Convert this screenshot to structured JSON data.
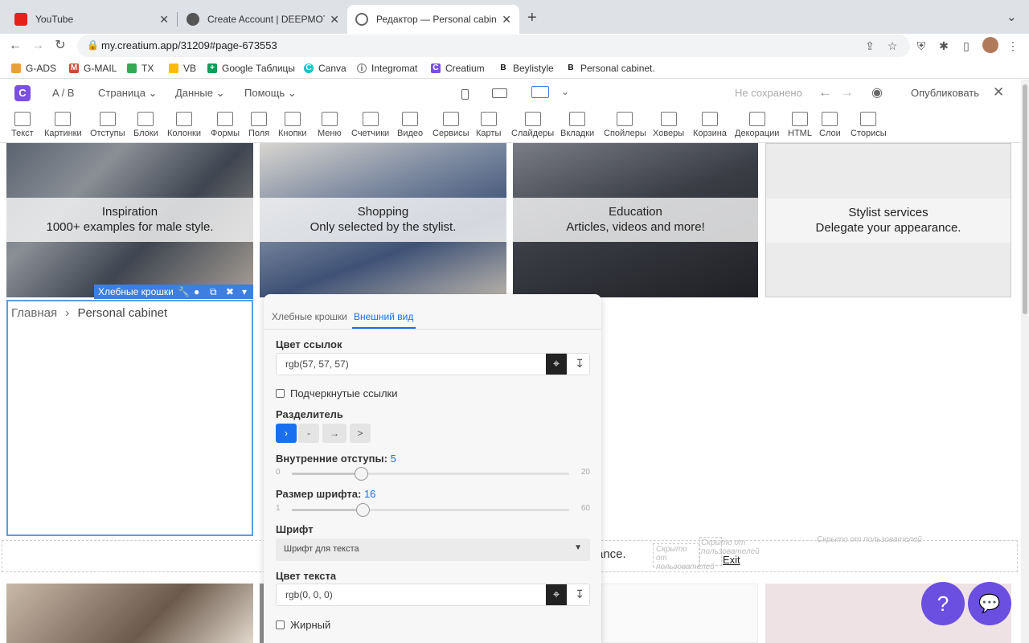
{
  "browser": {
    "tabs": [
      {
        "title": "YouTube",
        "close": "✕"
      },
      {
        "title": "Create Account | DEEPMOTION",
        "close": "✕"
      },
      {
        "title": "Редактор — Personal cabinet",
        "close": "✕"
      }
    ],
    "new_tab": "+",
    "tab_menu": "⌄",
    "url": "my.creatium.app/31209#page-673553",
    "bookmarks": [
      "G-ADS",
      "G-MAIL",
      "TX",
      "VB",
      "Google Таблицы",
      "Canva",
      "Integromat",
      "Creatium",
      "Beylistyle",
      "Personal cabinet."
    ]
  },
  "editor": {
    "logo": "C",
    "menu": {
      "ab": "A / B",
      "page": "Страница",
      "data": "Данные",
      "help": "Помощь"
    },
    "status": "Не сохранено",
    "publish": "Опубликовать",
    "tools": [
      "Текст",
      "Картинки",
      "Отступы",
      "Блоки",
      "Колонки",
      "Формы",
      "Поля",
      "Кнопки",
      "Меню",
      "Счетчики",
      "Видео",
      "Сервисы",
      "Карты",
      "Слайдеры",
      "Вкладки",
      "Спойлеры",
      "Ховеры",
      "Корзина",
      "Декорации",
      "HTML",
      "Слои",
      "Сторисы"
    ]
  },
  "cards": [
    {
      "title": "Inspiration",
      "subtitle": "1000+ examples for male style."
    },
    {
      "title": "Shopping",
      "subtitle": "Only selected by the stylist."
    },
    {
      "title": "Education",
      "subtitle": "Articles, videos and more!"
    },
    {
      "title": "Stylist services",
      "subtitle": "Delegate your appearance."
    }
  ],
  "breadcrumbs_block": {
    "label": "Хлебные крошки",
    "items": [
      "Главная",
      "Personal cabinet"
    ],
    "separator": "›"
  },
  "canvas_extra": {
    "partial_text": "ance.",
    "exit": "Exit",
    "hidden1": "Скрыто от пользователей",
    "hidden2": "Скрыто от пользователей",
    "hidden3": "Скрыто от пользователей"
  },
  "panel": {
    "tabs": [
      "Хлебные крошки",
      "Внешний вид"
    ],
    "link_color_label": "Цвет ссылок",
    "link_color_value": "rgb(57, 57, 57)",
    "underline_label": "Подчеркнутые ссылки",
    "separator_label": "Разделитель",
    "separators": [
      "›",
      "-",
      "→",
      ">"
    ],
    "padding_label": "Внутренние отступы:",
    "padding_value": "5",
    "padding_min": "0",
    "padding_max": "20",
    "font_size_label": "Размер шрифта:",
    "font_size_value": "16",
    "font_size_min": "1",
    "font_size_max": "60",
    "font_label": "Шрифт",
    "font_value": "Шрифт для текста",
    "text_color_label": "Цвет текста",
    "text_color_value": "rgb(0, 0, 0)",
    "bold_label": "Жирный"
  },
  "fabs": {
    "help": "?",
    "chat": "💬"
  },
  "colors": {
    "accent": "#1a6ff0",
    "selection": "#3d7ee0",
    "brand": "#7b4fe0"
  }
}
